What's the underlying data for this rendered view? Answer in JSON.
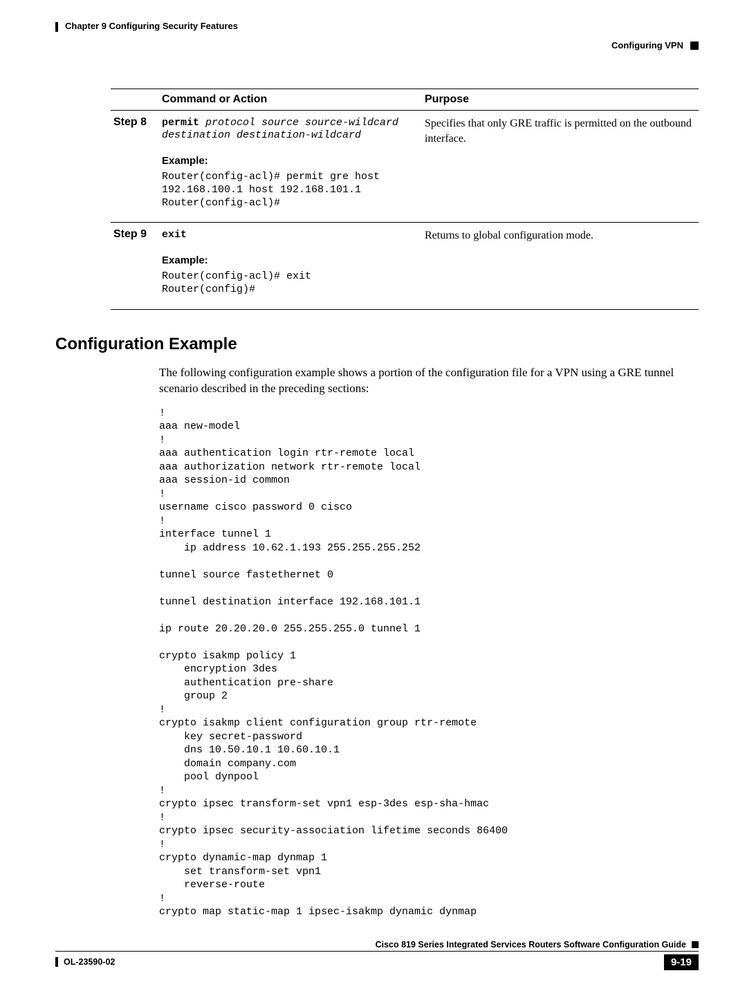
{
  "header": {
    "chapter": "Chapter 9    Configuring Security Features",
    "subsection": "Configuring VPN"
  },
  "table": {
    "head_command": "Command or Action",
    "head_purpose": "Purpose",
    "step8_label": "Step 8",
    "step8_cmd_bold": "permit",
    "step8_cmd_italic": " protocol source source-wildcard\ndestination destination-wildcard",
    "step8_example_label": "Example:",
    "step8_example": "Router(config-acl)# permit gre host\n192.168.100.1 host 192.168.101.1\nRouter(config-acl)#",
    "step8_purpose": "Specifies that only GRE traffic is permitted on the outbound interface.",
    "step9_label": "Step 9",
    "step9_cmd_bold": "exit",
    "step9_example_label": "Example:",
    "step9_example": "Router(config-acl)# exit\nRouter(config)#",
    "step9_purpose": "Returns to global configuration mode."
  },
  "section_heading": "Configuration Example",
  "intro_paragraph": "The following configuration example shows a portion of the configuration file for a VPN using a GRE tunnel scenario described in the preceding sections:",
  "config_block": "!\naaa new-model\n!\naaa authentication login rtr-remote local\naaa authorization network rtr-remote local\naaa session-id common\n!\nusername cisco password 0 cisco\n!\ninterface tunnel 1\n    ip address 10.62.1.193 255.255.255.252\n\ntunnel source fastethernet 0\n\ntunnel destination interface 192.168.101.1\n\nip route 20.20.20.0 255.255.255.0 tunnel 1\n\ncrypto isakmp policy 1\n    encryption 3des\n    authentication pre-share\n    group 2\n!\ncrypto isakmp client configuration group rtr-remote\n    key secret-password\n    dns 10.50.10.1 10.60.10.1\n    domain company.com\n    pool dynpool\n!\ncrypto ipsec transform-set vpn1 esp-3des esp-sha-hmac\n!\ncrypto ipsec security-association lifetime seconds 86400\n!\ncrypto dynamic-map dynmap 1\n    set transform-set vpn1\n    reverse-route\n!\ncrypto map static-map 1 ipsec-isakmp dynamic dynmap",
  "footer": {
    "guide": "Cisco 819 Series Integrated Services Routers Software Configuration Guide",
    "doc_id": "OL-23590-02",
    "page_num": "9-19"
  }
}
